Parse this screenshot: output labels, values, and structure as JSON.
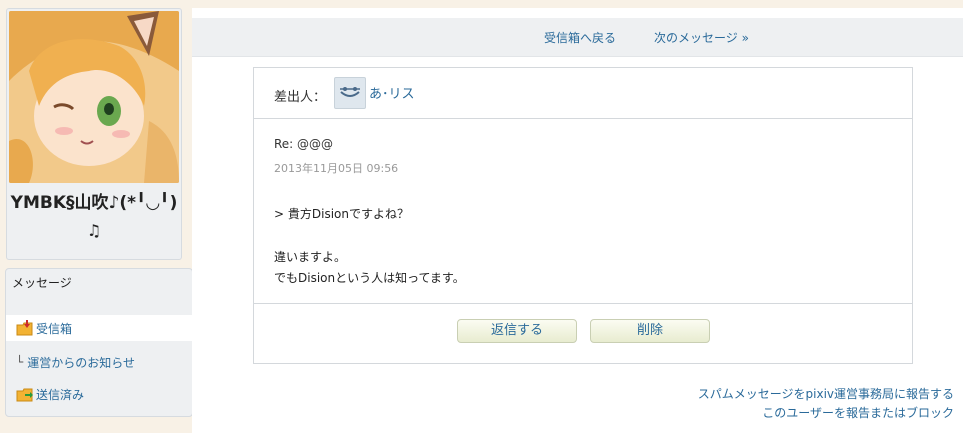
{
  "profile": {
    "username_line1": "YMBK§山吹♪(*╹◡╹)",
    "username_line2": "♫"
  },
  "sidebar": {
    "title": "メッセージ",
    "items": [
      {
        "label": "受信箱",
        "icon": "inbox-folder-icon",
        "active": true
      },
      {
        "label": "運営からのお知らせ",
        "prefix": "└"
      },
      {
        "label": "送信済み",
        "icon": "sent-folder-icon"
      }
    ]
  },
  "topnav": {
    "back_label": "受信箱へ戻る",
    "next_label": "次のメッセージ »"
  },
  "message": {
    "sender_label": "差出人：",
    "sender_name": "あ･リス",
    "subject": "Re: @@@",
    "date": "2013年11月05日 09:56",
    "body": [
      "> 貴方Disionですよね？",
      "違いますよ。",
      "でもDisionという人は知ってます。"
    ],
    "reply_label": "返信する",
    "delete_label": "削除"
  },
  "footer": {
    "report_spam": "スパムメッセージをpixiv運営事務局に報告する",
    "report_user": "このユーザーを報告またはブロック"
  },
  "colors": {
    "link": "#2a6a9a",
    "panel": "#eef0f2",
    "page_bg": "#f8f1e6"
  }
}
